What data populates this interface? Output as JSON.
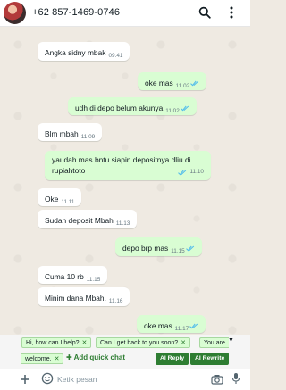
{
  "header": {
    "contact_name": "+62 857-1469-0746",
    "icons": [
      "search-icon",
      "more-vertical-icon"
    ]
  },
  "messages": [
    {
      "direction": "in",
      "text": "Angka sidny mbak",
      "time": "09.41",
      "read": false
    },
    {
      "direction": "out",
      "text": "oke mas",
      "time": "11.02",
      "read": true
    },
    {
      "direction": "out",
      "text": "udh di depo belum akunya",
      "time": "11.02",
      "read": true
    },
    {
      "direction": "in",
      "text": "Blm mbah",
      "time": "11.09",
      "read": false
    },
    {
      "direction": "out",
      "text": "yaudah mas bntu siapin depositnya dliu di rupiahtoto",
      "time": "11.10",
      "read": true
    },
    {
      "direction": "in",
      "text": "Oke",
      "time": "11.11",
      "read": false
    },
    {
      "direction": "in",
      "text": "Sudah deposit Mbah",
      "time": "11.13",
      "read": false
    },
    {
      "direction": "out",
      "text": "depo brp mas",
      "time": "11.15",
      "read": true
    },
    {
      "direction": "in",
      "text": "Cuma 10 rb",
      "time": "11.15",
      "read": false
    },
    {
      "direction": "in",
      "text": "Minim dana Mbah.",
      "time": "11.16",
      "read": false
    },
    {
      "direction": "out",
      "text": "oke mas",
      "time": "11.17",
      "read": true
    }
  ],
  "suggestions": {
    "chips": [
      "Hi, how can I help?",
      "Can I get back to you soon?",
      "You are",
      "welcome."
    ],
    "add_quick_chat": "Add quick chat",
    "ai_reply": "AI Reply",
    "ai_rewrite": "AI Rewrite",
    "expand_icon": "caret-down-icon",
    "accent_color": "#2e7d32"
  },
  "composer": {
    "placeholder": "Ketik pesan",
    "icons": [
      "plus-icon",
      "sticker-icon",
      "camera-icon",
      "microphone-icon"
    ]
  },
  "colors": {
    "chat_background": "#efeae2",
    "outgoing_bubble": "#d9fdd3",
    "incoming_bubble": "#ffffff",
    "read_ticks": "#53bdeb"
  }
}
